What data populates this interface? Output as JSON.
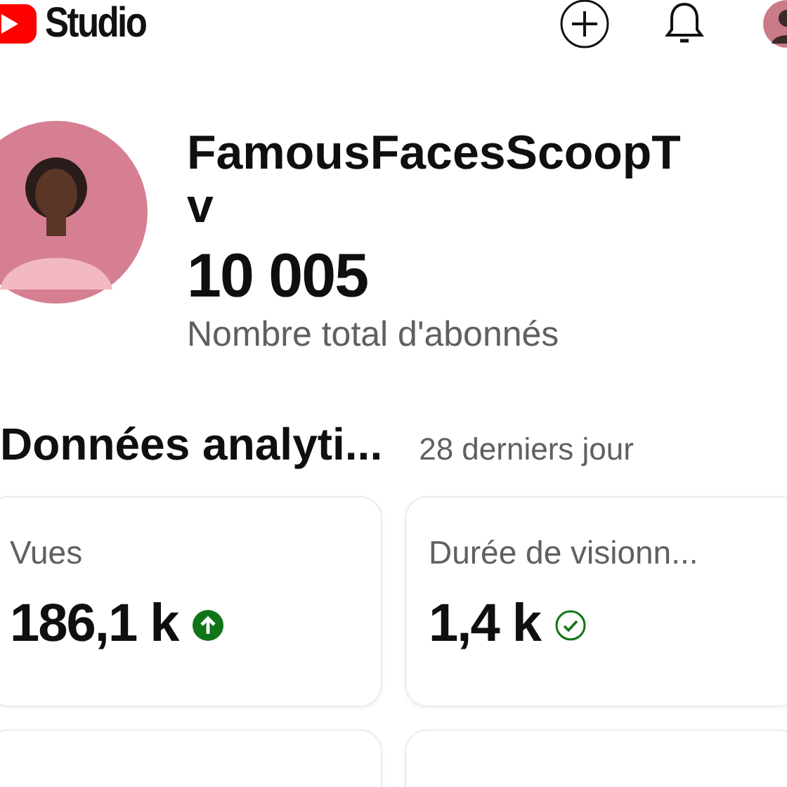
{
  "header": {
    "logo_text": "Studio"
  },
  "channel": {
    "name_lines": [
      "FamousFacesScoopT",
      "v"
    ],
    "subscribers": "10 005",
    "subscribers_label": "Nombre total d'abonnés"
  },
  "analytics": {
    "title": "Données analyti...",
    "period": "28 derniers jour",
    "cards": [
      {
        "label": "Vues",
        "value": "186,1 k",
        "kind": "up"
      },
      {
        "label": "Durée de visionn...",
        "value": "1,4 k",
        "kind": "ok"
      }
    ]
  }
}
